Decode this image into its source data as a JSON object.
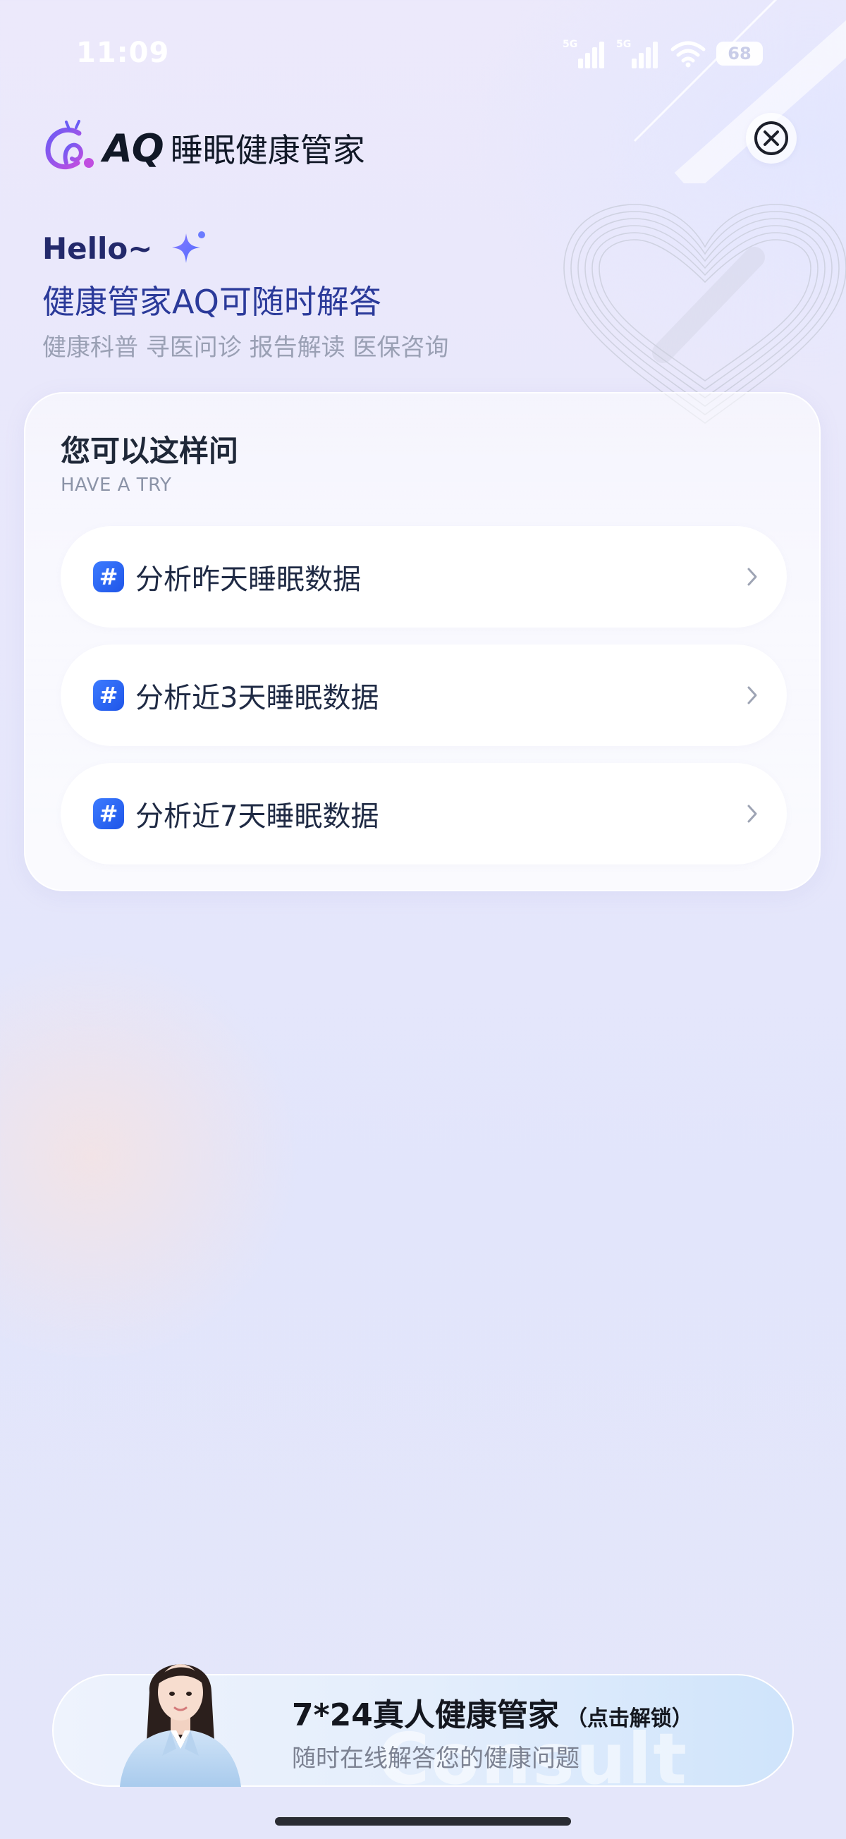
{
  "status_bar": {
    "time": "11:09",
    "network_1": "5G",
    "network_2": "5G",
    "battery": "68"
  },
  "header": {
    "app_title_prefix": "AQ",
    "app_title": "睡眠健康管家"
  },
  "greeting": {
    "hello": "Hello~",
    "subtitle": "健康管家AQ可随时解答",
    "topics": "健康科普 寻医问诊 报告解读 医保咨询"
  },
  "try_card": {
    "title": "您可以这样问",
    "subtitle": "HAVE A TRY",
    "suggestions": [
      {
        "label": "分析昨天睡眠数据"
      },
      {
        "label": "分析近3天睡眠数据"
      },
      {
        "label": "分析近7天睡眠数据"
      }
    ]
  },
  "human_banner": {
    "title": "7*24真人健康管家",
    "hint": "（点击解锁）",
    "subtitle": "随时在线解答您的健康问题",
    "watermark": "Consult"
  },
  "colors": {
    "accent_blue": "#2b3a9a",
    "hash_icon_blue": "#1f55e8",
    "logo_purple": "#8b5cf6"
  }
}
